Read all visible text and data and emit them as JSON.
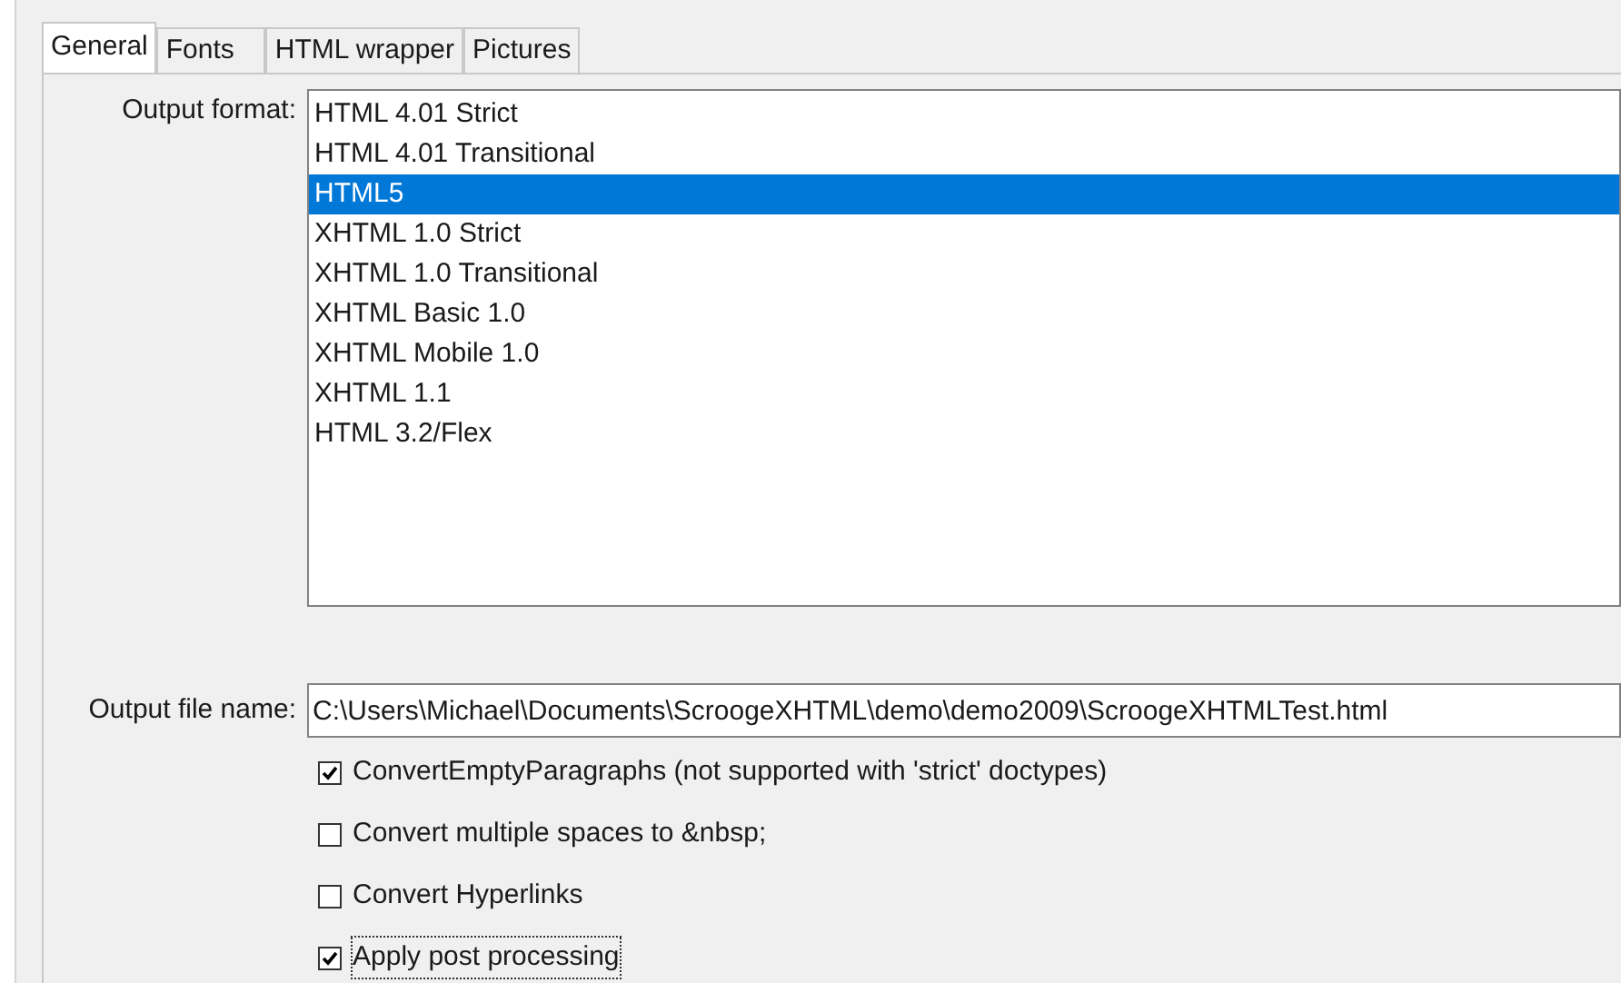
{
  "tabs": [
    {
      "label": "General",
      "selected": true
    },
    {
      "label": "Fonts",
      "selected": false
    },
    {
      "label": "HTML wrapper",
      "selected": false
    },
    {
      "label": "Pictures",
      "selected": false
    }
  ],
  "output_format": {
    "label": "Output format:",
    "items": [
      {
        "label": "HTML 4.01 Strict",
        "selected": false
      },
      {
        "label": "HTML 4.01 Transitional",
        "selected": false
      },
      {
        "label": "HTML5",
        "selected": true
      },
      {
        "label": "XHTML 1.0 Strict",
        "selected": false
      },
      {
        "label": "XHTML 1.0 Transitional",
        "selected": false
      },
      {
        "label": "XHTML Basic 1.0",
        "selected": false
      },
      {
        "label": "XHTML Mobile 1.0",
        "selected": false
      },
      {
        "label": "XHTML 1.1",
        "selected": false
      },
      {
        "label": "HTML 3.2/Flex",
        "selected": false
      }
    ]
  },
  "output_file": {
    "label": "Output file name:",
    "value": "C:\\Users\\Michael\\Documents\\ScroogeXHTML\\demo\\demo2009\\ScroogeXHTMLTest.html"
  },
  "options": [
    {
      "label": "ConvertEmptyParagraphs (not supported with 'strict' doctypes)",
      "checked": true,
      "focused": false
    },
    {
      "label": "Convert multiple spaces to &nbsp;",
      "checked": false,
      "focused": false
    },
    {
      "label": "Convert Hyperlinks",
      "checked": false,
      "focused": false
    },
    {
      "label": "Apply post processing",
      "checked": true,
      "focused": true
    }
  ]
}
